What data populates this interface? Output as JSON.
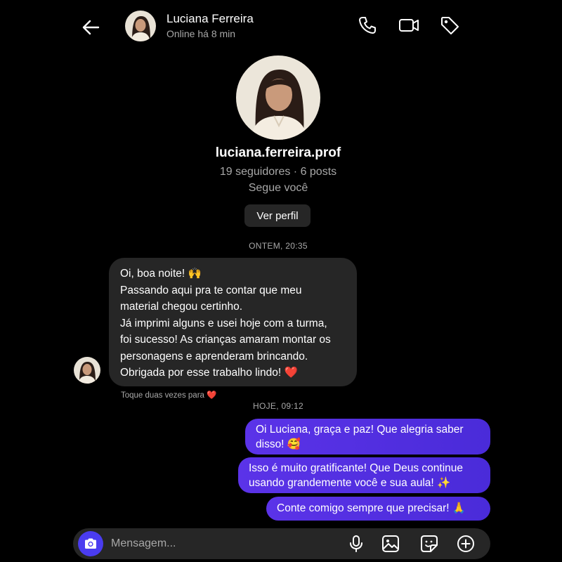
{
  "header": {
    "name": "Luciana Ferreira",
    "status": "Online há 8 min",
    "icons": [
      "back-arrow-icon",
      "phone-icon",
      "video-icon",
      "tag-icon"
    ]
  },
  "profile": {
    "username": "luciana.ferreira.prof",
    "stats": "19 seguidores · 6 posts",
    "follow_status": "Segue você",
    "view_profile_label": "Ver perfil"
  },
  "conversation": {
    "timestamp_1": "ONTEM, 20:35",
    "incoming_lines": [
      "Oi, boa noite! 🙌",
      "Passando aqui pra te contar que meu",
      "material chegou certinho.",
      "Já imprimi alguns e usei hoje com a turma,",
      "foi sucesso! As crianças amaram montar os",
      "personagens e aprenderam brincando.",
      "Obrigada por esse trabalho lindo! ❤️"
    ],
    "tap_hint": "Toque duas vezes para ❤️",
    "timestamp_2": "HOJE, 09:12",
    "outgoing": [
      [
        "Oi Luciana, graça e paz! Que alegria saber",
        "disso! 🥰"
      ],
      [
        "Isso é muito gratificante! Que Deus continue",
        "usando grandemente você e sua aula! ✨"
      ],
      [
        "Conte comigo sempre que precisar! 🙏"
      ]
    ]
  },
  "composer": {
    "placeholder": "Mensagem...",
    "icons": [
      "camera-icon",
      "microphone-icon",
      "image-icon",
      "sticker-icon",
      "plus-icon"
    ]
  },
  "colors": {
    "background": "#000000",
    "incoming_bubble": "#262626",
    "outgoing_bubble": "#4c2fe0",
    "secondary_text": "#a8a8a8",
    "camera_button": "#4a3cf0"
  }
}
